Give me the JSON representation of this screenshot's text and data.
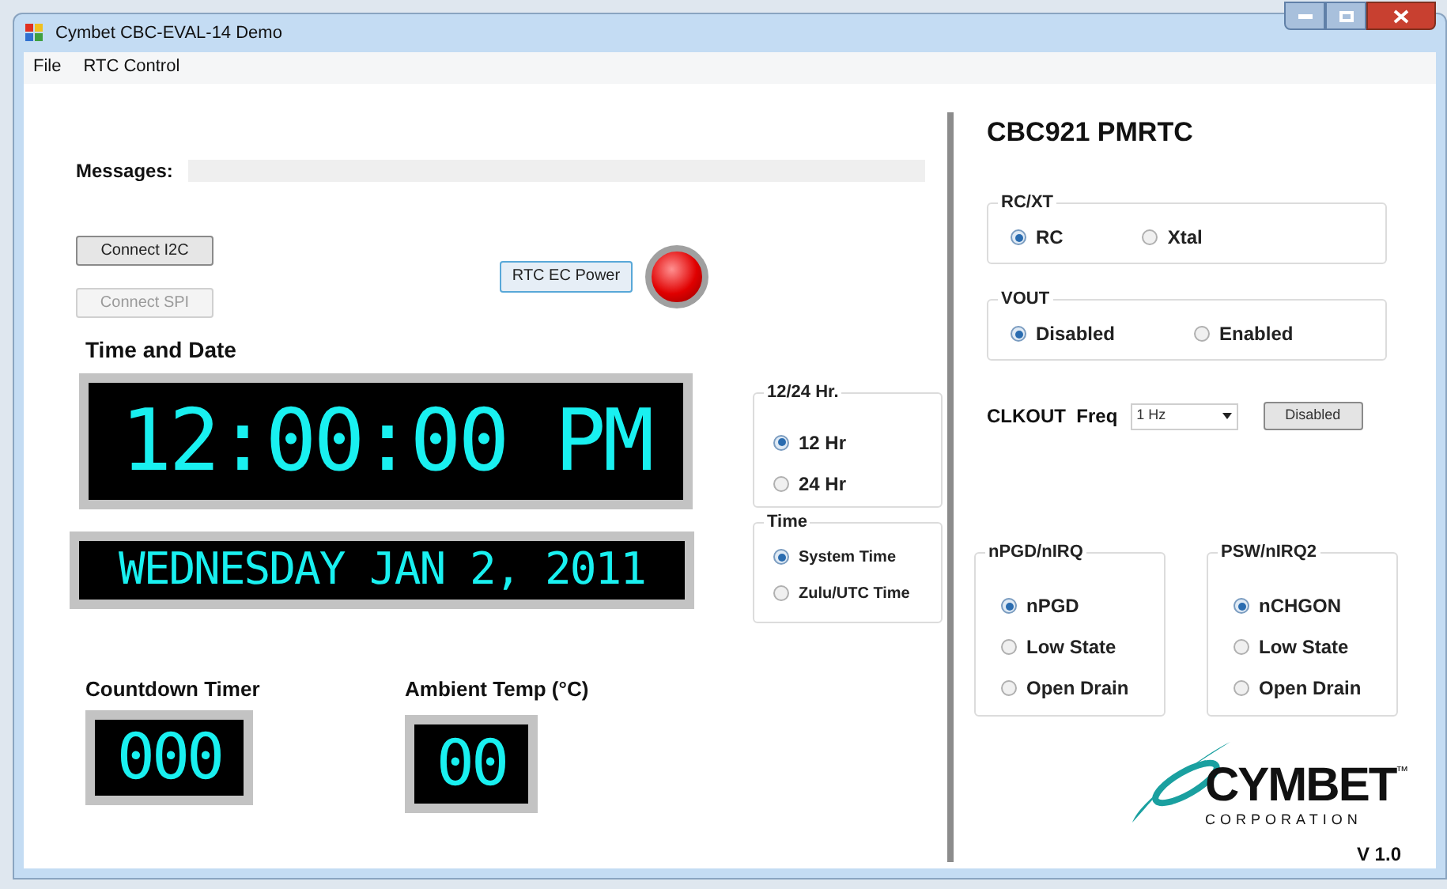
{
  "window": {
    "title": "Cymbet CBC-EVAL-14 Demo"
  },
  "menu": [
    {
      "label": "File"
    },
    {
      "label": "RTC Control"
    }
  ],
  "messages": {
    "label": "Messages:"
  },
  "connect_buttons": [
    {
      "label": "Connect I2C",
      "disabled": false
    },
    {
      "label": "Connect SPI",
      "disabled": true
    }
  ],
  "rtc_power": {
    "label": "RTC EC  Power",
    "on": true
  },
  "time_and_date": {
    "heading": "Time and Date",
    "time": "12:00:00 PM",
    "date": "WEDNESDAY JAN 2, 2011"
  },
  "left_groups": [
    {
      "title": "12/24 Hr.",
      "options": [
        {
          "label": "12 Hr",
          "selected": true
        },
        {
          "label": "24 Hr",
          "selected": false
        }
      ]
    },
    {
      "title": "Time",
      "options": [
        {
          "label": "System Time",
          "selected": true
        },
        {
          "label": "Zulu/UTC Time",
          "selected": false
        }
      ]
    }
  ],
  "countdown": {
    "label": "Countdown Timer",
    "value": "000"
  },
  "ambient": {
    "label": "Ambient Temp (°C)",
    "value": "00"
  },
  "device": {
    "title": "CBC921 PMRTC"
  },
  "right_groups": [
    {
      "title": "RC/XT",
      "options": [
        {
          "label": "RC",
          "selected": true
        },
        {
          "label": "Xtal",
          "selected": false
        }
      ]
    },
    {
      "title": "VOUT",
      "options": [
        {
          "label": "Disabled",
          "selected": true
        },
        {
          "label": "Enabled",
          "selected": false
        }
      ]
    }
  ],
  "clkout": {
    "label": "CLKOUT  Freq",
    "value": "1 Hz",
    "button": "Disabled"
  },
  "pin_groups": [
    {
      "title": "nPGD/nIRQ",
      "options": [
        {
          "label": "nPGD",
          "selected": true
        },
        {
          "label": "Low State",
          "selected": false
        },
        {
          "label": "Open Drain",
          "selected": false
        }
      ]
    },
    {
      "title": "PSW/nIRQ2",
      "options": [
        {
          "label": "nCHGON",
          "selected": true
        },
        {
          "label": "Low State",
          "selected": false
        },
        {
          "label": "Open Drain",
          "selected": false
        }
      ]
    }
  ],
  "logo": {
    "name": "CYMBET",
    "mark": "™",
    "sub": "CORPORATION"
  },
  "version": "V 1.0"
}
